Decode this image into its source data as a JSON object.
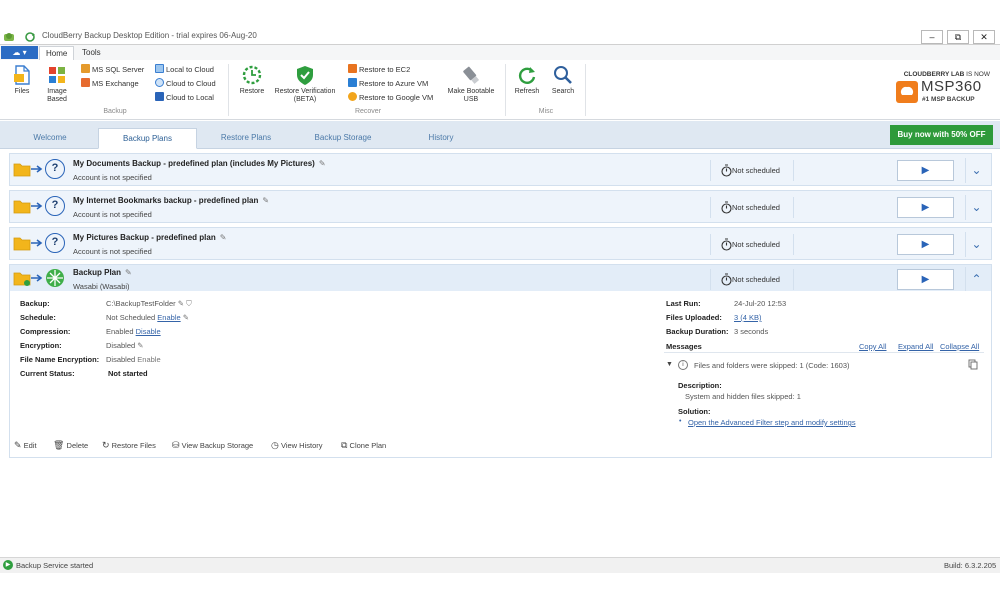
{
  "window": {
    "title": "CloudBerry Backup Desktop Edition - trial expires 06-Aug-20",
    "minimize": "–",
    "restore": "⧉",
    "close": "✕"
  },
  "menu": {
    "home": "Home",
    "tools": "Tools"
  },
  "ribbon": {
    "files": "Files",
    "image_based": "Image Based",
    "ms_sql": "MS SQL Server",
    "ms_exchange": "MS Exchange",
    "local_to_cloud": "Local to Cloud",
    "cloud_to_cloud": "Cloud to Cloud",
    "cloud_to_local": "Cloud to Local",
    "backup_group": "Backup",
    "restore": "Restore",
    "restore_verification": "Restore Verification (BETA)",
    "restore_ec2": "Restore to EC2",
    "restore_azure": "Restore to Azure VM",
    "restore_google": "Restore to Google VM",
    "make_bootable": "Make Bootable USB",
    "recover_group": "Recover",
    "refresh": "Refresh",
    "search": "Search",
    "misc_group": "Misc"
  },
  "brand": {
    "line1_a": "CLOUDBERRY LAB",
    "line1_b": " IS NOW",
    "name": "MSP360",
    "tagline": "#1 MSP BACKUP"
  },
  "tabs": [
    "Welcome",
    "Backup Plans",
    "Restore Plans",
    "Backup Storage",
    "History"
  ],
  "buy_button": "Buy now with 50% OFF",
  "plans": [
    {
      "title": "My Documents Backup - predefined plan (includes My Pictures)",
      "subtitle": "Account is not specified",
      "schedule": "Not scheduled"
    },
    {
      "title": "My Internet Bookmarks backup - predefined plan",
      "subtitle": "Account is not specified",
      "schedule": "Not scheduled"
    },
    {
      "title": "My Pictures Backup - predefined plan",
      "subtitle": "Account is not specified",
      "schedule": "Not scheduled"
    },
    {
      "title": "Backup Plan",
      "subtitle": "Wasabi (Wasabi)",
      "schedule": "Not scheduled"
    }
  ],
  "details": {
    "backup_label": "Backup:",
    "backup_value": "C:\\BackupTestFolder",
    "schedule_label": "Schedule:",
    "schedule_value": "Not Scheduled",
    "schedule_link": "Enable",
    "compression_label": "Compression:",
    "compression_value": "Enabled",
    "compression_link": "Disable",
    "encryption_label": "Encryption:",
    "encryption_value": "Disabled",
    "fne_label": "File Name Encryption:",
    "fne_value": "Disabled",
    "fne_link": "Enable",
    "status_label": "Current Status:",
    "status_value": "Not started",
    "last_run_label": "Last Run:",
    "last_run_value": "24-Jul-20 12:53",
    "files_uploaded_label": "Files Uploaded:",
    "files_uploaded_value": "3 (4 KB)",
    "duration_label": "Backup Duration:",
    "duration_value": "3 seconds",
    "messages_label": "Messages",
    "copy_all": "Copy All",
    "expand_all": "Expand All",
    "collapse_all": "Collapse All",
    "message": "Files and folders were skipped: 1 (Code: 1603)",
    "description_label": "Description:",
    "description_value": "System and hidden files skipped: 1",
    "solution_label": "Solution:",
    "solution_link": "Open the Advanced Filter step and modify settings"
  },
  "actions": {
    "edit": "Edit",
    "delete": "Delete",
    "restore_files": "Restore Files",
    "view_storage": "View Backup Storage",
    "view_history": "View History",
    "clone": "Clone Plan"
  },
  "status": {
    "service": "Backup Service started",
    "build": "Build: 6.3.2.205"
  },
  "colors": {
    "accent": "#2b6cc4",
    "buy_green": "#2e9a3a",
    "tab_bar": "#dfe8f2",
    "plan_bg": "#eef4fb",
    "brand_orange": "#f07d1c",
    "wasabi_green": "#3fae49"
  }
}
